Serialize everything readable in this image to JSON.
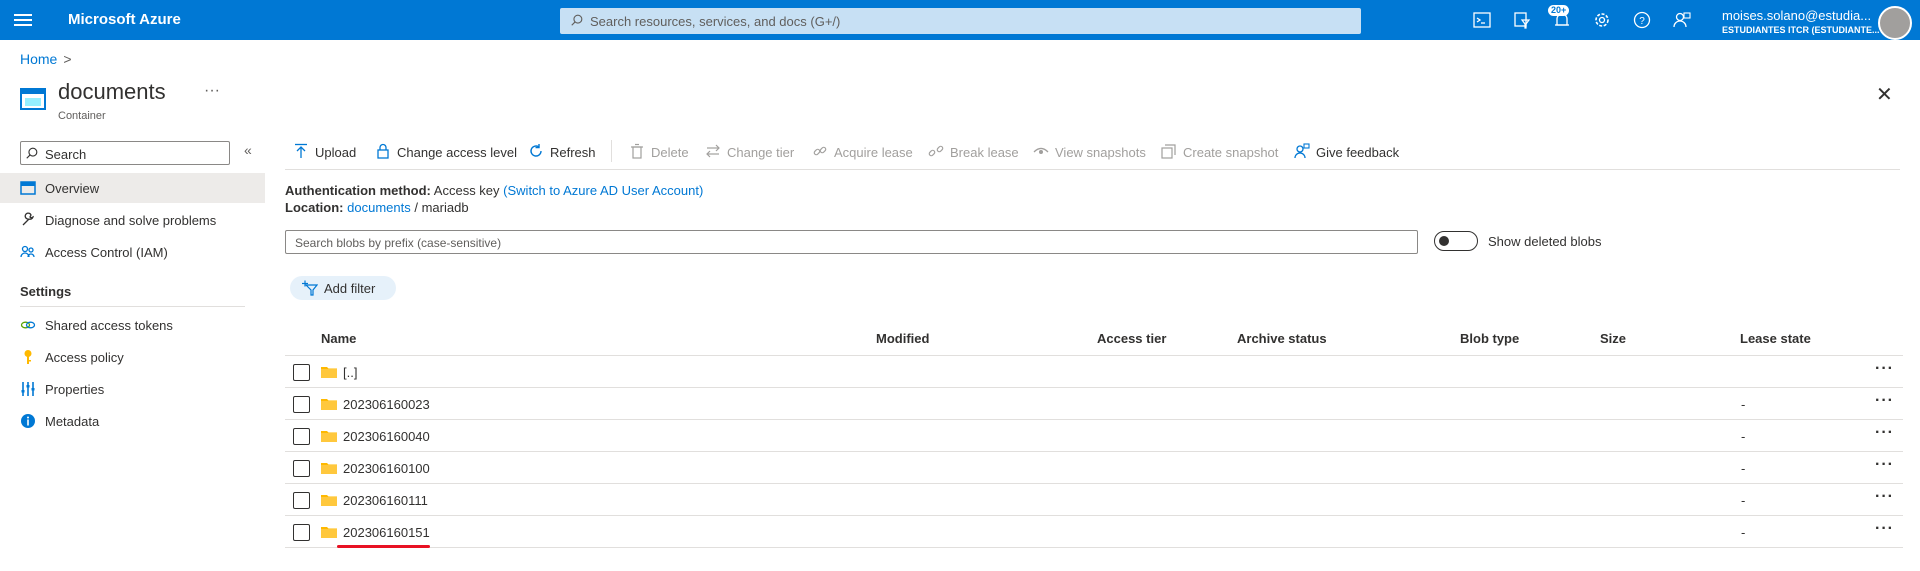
{
  "topbar": {
    "brand": "Microsoft Azure",
    "search_placeholder": "Search resources, services, and docs (G+/)",
    "notifications_badge": "20+",
    "account_name": "moises.solano@estudia...",
    "account_directory": "ESTUDIANTES ITCR (ESTUDIANTE..."
  },
  "breadcrumb": {
    "home": "Home",
    "separator": ">"
  },
  "resource": {
    "title": "documents",
    "subtitle": "Container",
    "more": "···",
    "close": "✕"
  },
  "nav": {
    "search_placeholder": "Search",
    "collapse": "«",
    "items": [
      {
        "label": "Overview",
        "icon": "overview-icon"
      },
      {
        "label": "Diagnose and solve problems",
        "icon": "wrench-icon"
      },
      {
        "label": "Access Control (IAM)",
        "icon": "people-icon"
      }
    ],
    "settings_title": "Settings",
    "settings_items": [
      {
        "label": "Shared access tokens",
        "icon": "link-icon"
      },
      {
        "label": "Access policy",
        "icon": "key-icon"
      },
      {
        "label": "Properties",
        "icon": "properties-icon"
      },
      {
        "label": "Metadata",
        "icon": "info-icon"
      }
    ]
  },
  "toolbar": {
    "upload": "Upload",
    "change_access": "Change access level",
    "refresh": "Refresh",
    "delete": "Delete",
    "change_tier": "Change tier",
    "acquire_lease": "Acquire lease",
    "break_lease": "Break lease",
    "view_snapshots": "View snapshots",
    "create_snapshot": "Create snapshot",
    "give_feedback": "Give feedback"
  },
  "info": {
    "auth_label": "Authentication method:",
    "auth_value": "Access key",
    "auth_link": "(Switch to Azure AD User Account)",
    "location_label": "Location:",
    "location_link": "documents",
    "location_sep": "/",
    "location_path": "mariadb"
  },
  "blob_search": {
    "placeholder": "Search blobs by prefix (case-sensitive)",
    "show_deleted": "Show deleted blobs"
  },
  "filter": {
    "add_filter": "Add filter"
  },
  "table": {
    "headers": {
      "name": "Name",
      "modified": "Modified",
      "access_tier": "Access tier",
      "archive_status": "Archive status",
      "blob_type": "Blob type",
      "size": "Size",
      "lease_state": "Lease state"
    },
    "rows": [
      {
        "name": "[..]",
        "lease": ""
      },
      {
        "name": "202306160023",
        "lease": "-"
      },
      {
        "name": "202306160040",
        "lease": "-"
      },
      {
        "name": "202306160100",
        "lease": "-"
      },
      {
        "name": "202306160111",
        "lease": "-"
      },
      {
        "name": "202306160151",
        "lease": "-"
      }
    ],
    "row_more": "···"
  },
  "colors": {
    "brand_blue": "#0078d4",
    "folder_yellow": "#ffb900",
    "highlight_red": "#e81123"
  }
}
